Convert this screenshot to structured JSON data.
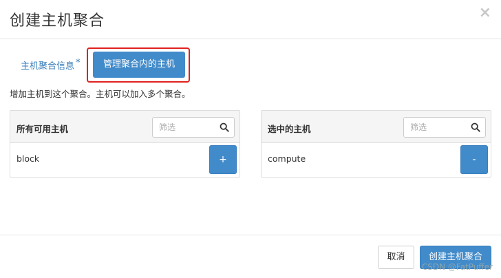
{
  "dialog": {
    "title": "创建主机聚合",
    "close_glyph": "×"
  },
  "tabs": {
    "info_label": "主机聚合信息",
    "required_mark": "*",
    "active_label": "管理聚合内的主机"
  },
  "description": "增加主机到这个聚合。主机可以加入多个聚合。",
  "available": {
    "title": "所有可用主机",
    "filter_placeholder": "筛选",
    "items": [
      {
        "name": "block",
        "action": "+"
      }
    ]
  },
  "selected": {
    "title": "选中的主机",
    "filter_placeholder": "筛选",
    "items": [
      {
        "name": "compute",
        "action": "-"
      }
    ]
  },
  "footer": {
    "cancel_label": "取消",
    "create_label": "创建主机聚合"
  },
  "watermark": "CSDN @FatPuffer",
  "colors": {
    "primary": "#428bca",
    "highlight_border": "#e0201e",
    "link": "#337ab7"
  },
  "icons": {
    "search": "search-icon",
    "close": "close-icon"
  }
}
